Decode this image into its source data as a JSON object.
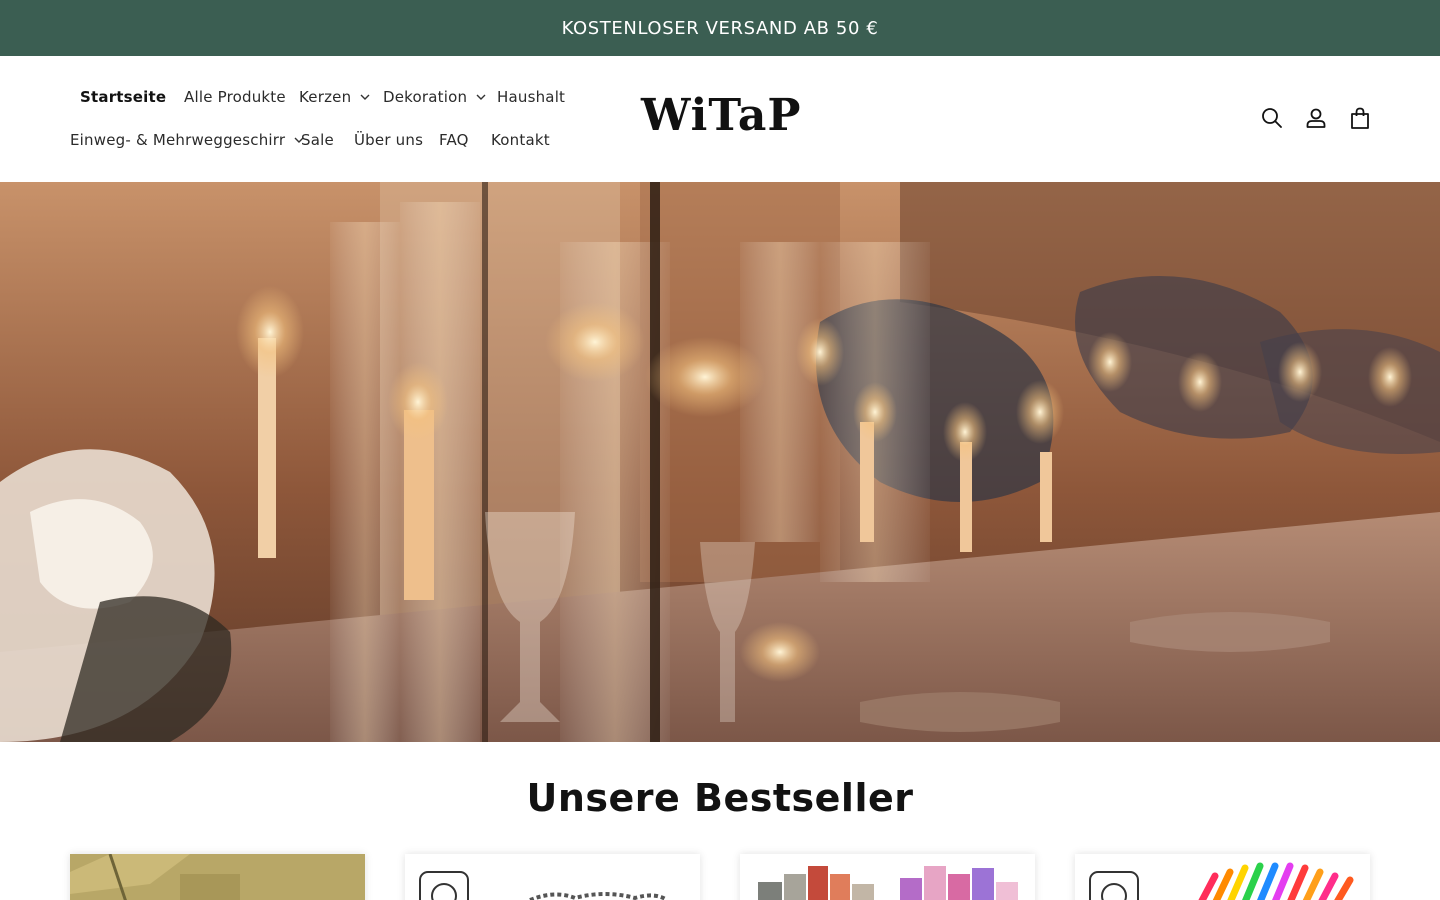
{
  "announcement": {
    "text": "KOSTENLOSER VERSAND AB 50 €"
  },
  "header": {
    "logo": "WiTaP",
    "nav": [
      {
        "label": "Startseite",
        "active": true
      },
      {
        "label": "Alle Produkte"
      },
      {
        "label": "Kerzen",
        "dropdown": true
      },
      {
        "label": "Dekoration",
        "dropdown": true
      },
      {
        "label": "Haushalt"
      },
      {
        "label": "Einweg- & Mehrweggeschirr",
        "dropdown": true
      },
      {
        "label": "Sale"
      },
      {
        "label": "Über uns"
      },
      {
        "label": "FAQ"
      },
      {
        "label": "Kontakt"
      }
    ],
    "icons": [
      "search-icon",
      "account-icon",
      "cart-icon"
    ]
  },
  "hero": {
    "image": "candlelit-table-photo"
  },
  "bestsellers": {
    "title": "Unsere Bestseller"
  },
  "colors": {
    "announcement_bg": "#3b5e52",
    "text": "#121212"
  }
}
